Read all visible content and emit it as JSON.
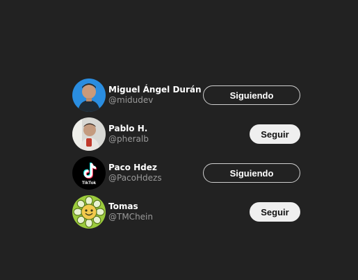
{
  "users": [
    {
      "name": "Miguel Ángel Durán",
      "handle": "@midudev",
      "button": "Siguiendo",
      "following": true,
      "avatar": "avatar-midudev"
    },
    {
      "name": "Pablo H.",
      "handle": "@pheralb",
      "button": "Seguir",
      "following": false,
      "avatar": "avatar-pheralb"
    },
    {
      "name": "Paco Hdez",
      "handle": "@PacoHdezs",
      "button": "Siguiendo",
      "following": true,
      "avatar": "tiktok-logo",
      "avatar_text": "TikTok"
    },
    {
      "name": "Tomas",
      "handle": "@TMChein",
      "button": "Seguir",
      "following": false,
      "avatar": "sunflower-avatar"
    }
  ],
  "colors": {
    "background": "#222222",
    "follow_button": "#efefef",
    "following_border": "#cfcfcf",
    "handle_text": "#9a9a9a"
  }
}
